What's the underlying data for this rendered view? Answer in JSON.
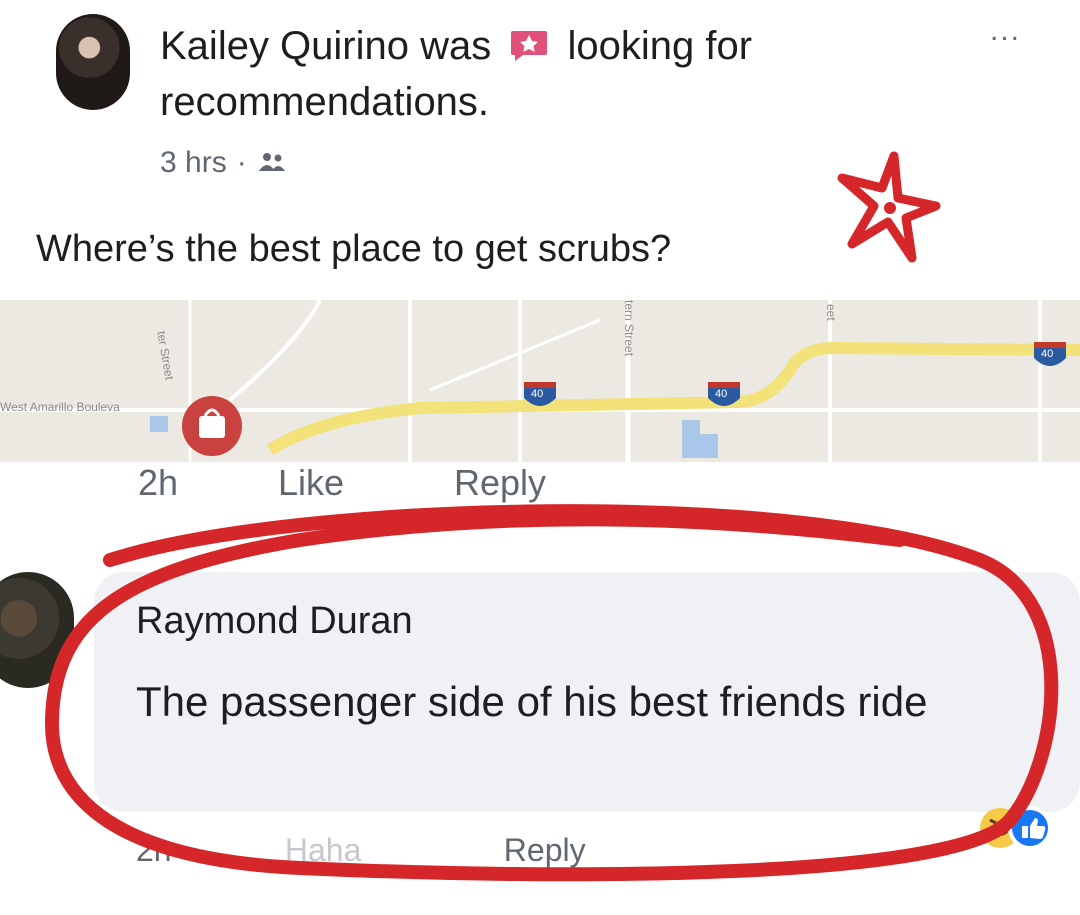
{
  "post": {
    "author": "Kailey Quirino",
    "action_prefix": "was",
    "action_suffix": "looking for recommendations.",
    "activity_icon": "recommendation-icon",
    "time": "3 hrs",
    "separator": "·",
    "audience_icon": "friends-icon",
    "more_icon": "...",
    "text": "Where’s the best place to get scrubs?"
  },
  "map": {
    "street_1": "West Amarillo Bouleva",
    "street_2": "ter Street",
    "street_3": "tern Street",
    "street_4": "eet",
    "highway_shield_1": "40",
    "highway_shield_2": "40",
    "highway_shield_3": "40",
    "pin_icon": "shopping-bag-pin-icon"
  },
  "post_actions": {
    "time": "2h",
    "like_label": "Like",
    "reply_label": "Reply"
  },
  "comment": {
    "author": "Raymond Duran",
    "text": "The passenger side of his best friends ride",
    "time": "2h",
    "like_label": "Haha",
    "reply_label": "Reply",
    "reaction_icons": [
      "haha-icon",
      "like-icon"
    ]
  },
  "colors": {
    "annotation_red": "#d5262a",
    "facebook_blue": "#1877f2",
    "highway_yellow": "#f3e27a"
  }
}
